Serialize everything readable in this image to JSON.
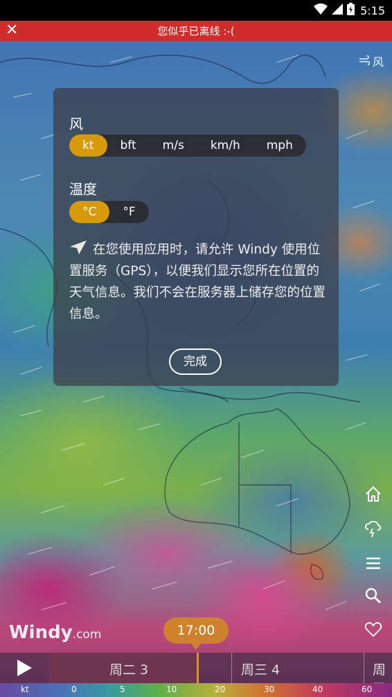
{
  "status_bar": {
    "time": "5:15"
  },
  "banner": {
    "close": "✕",
    "text": "您似乎已离线 :-("
  },
  "layer": {
    "label": "风"
  },
  "settings": {
    "wind_title": "风",
    "wind_units": [
      "kt",
      "bft",
      "m/s",
      "km/h",
      "mph"
    ],
    "wind_selected": "kt",
    "temp_title": "温度",
    "temp_units": [
      "°C",
      "°F"
    ],
    "temp_selected": "°C",
    "gps_message": "在您使用应用时，请允许 Windy 使用位置服务（GPS），以便我们显示您所在位置的天气信息。我们不会在服务器上储存您的位置信息。",
    "done_label": "完成"
  },
  "logo": {
    "name": "Windy",
    "suffix": ".com"
  },
  "timeline": {
    "current_time": "17:00",
    "days": [
      "周二 3",
      "周三 4",
      "周四"
    ]
  },
  "legend": {
    "unit": "kt",
    "ticks": [
      "0",
      "5",
      "10",
      "20",
      "30",
      "40",
      "60"
    ]
  },
  "colors": {
    "accent": "#d69a0a",
    "banner": "#d02c2c"
  }
}
